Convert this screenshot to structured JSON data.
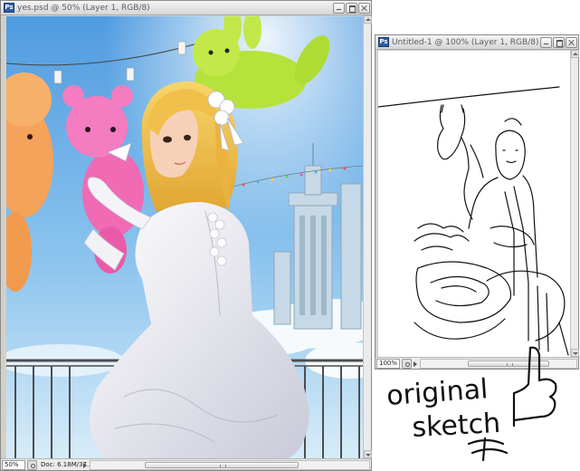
{
  "windows": {
    "painting": {
      "title": "yes.psd @ 50% (Layer 1, RGB/8)",
      "app_badge": "Ps",
      "zoom": "50%",
      "doc_info": "Doc: 6.18M/37.2M"
    },
    "sketch": {
      "title": "Untitled-1 @ 100% (Layer 1, RGB/8)",
      "app_badge": "Ps",
      "zoom": "100%"
    }
  },
  "annotation": {
    "line1": "original",
    "line2": "sketch"
  },
  "icons": [
    "photoshop-icon",
    "minimize-icon",
    "maximize-icon",
    "close-icon",
    "scroll-up-arrow-icon",
    "scroll-down-arrow-icon",
    "status-menu-arrow-icon",
    "thumbs-up-icon"
  ],
  "colors": {
    "sky": "#6aaee6",
    "hair": "#f2c24c",
    "pink_bear": "#f06ab4",
    "green_bunny": "#b6e23c",
    "orange_bear": "#f5a25a",
    "dress": "#f2f2f6",
    "ink": "#111111"
  }
}
